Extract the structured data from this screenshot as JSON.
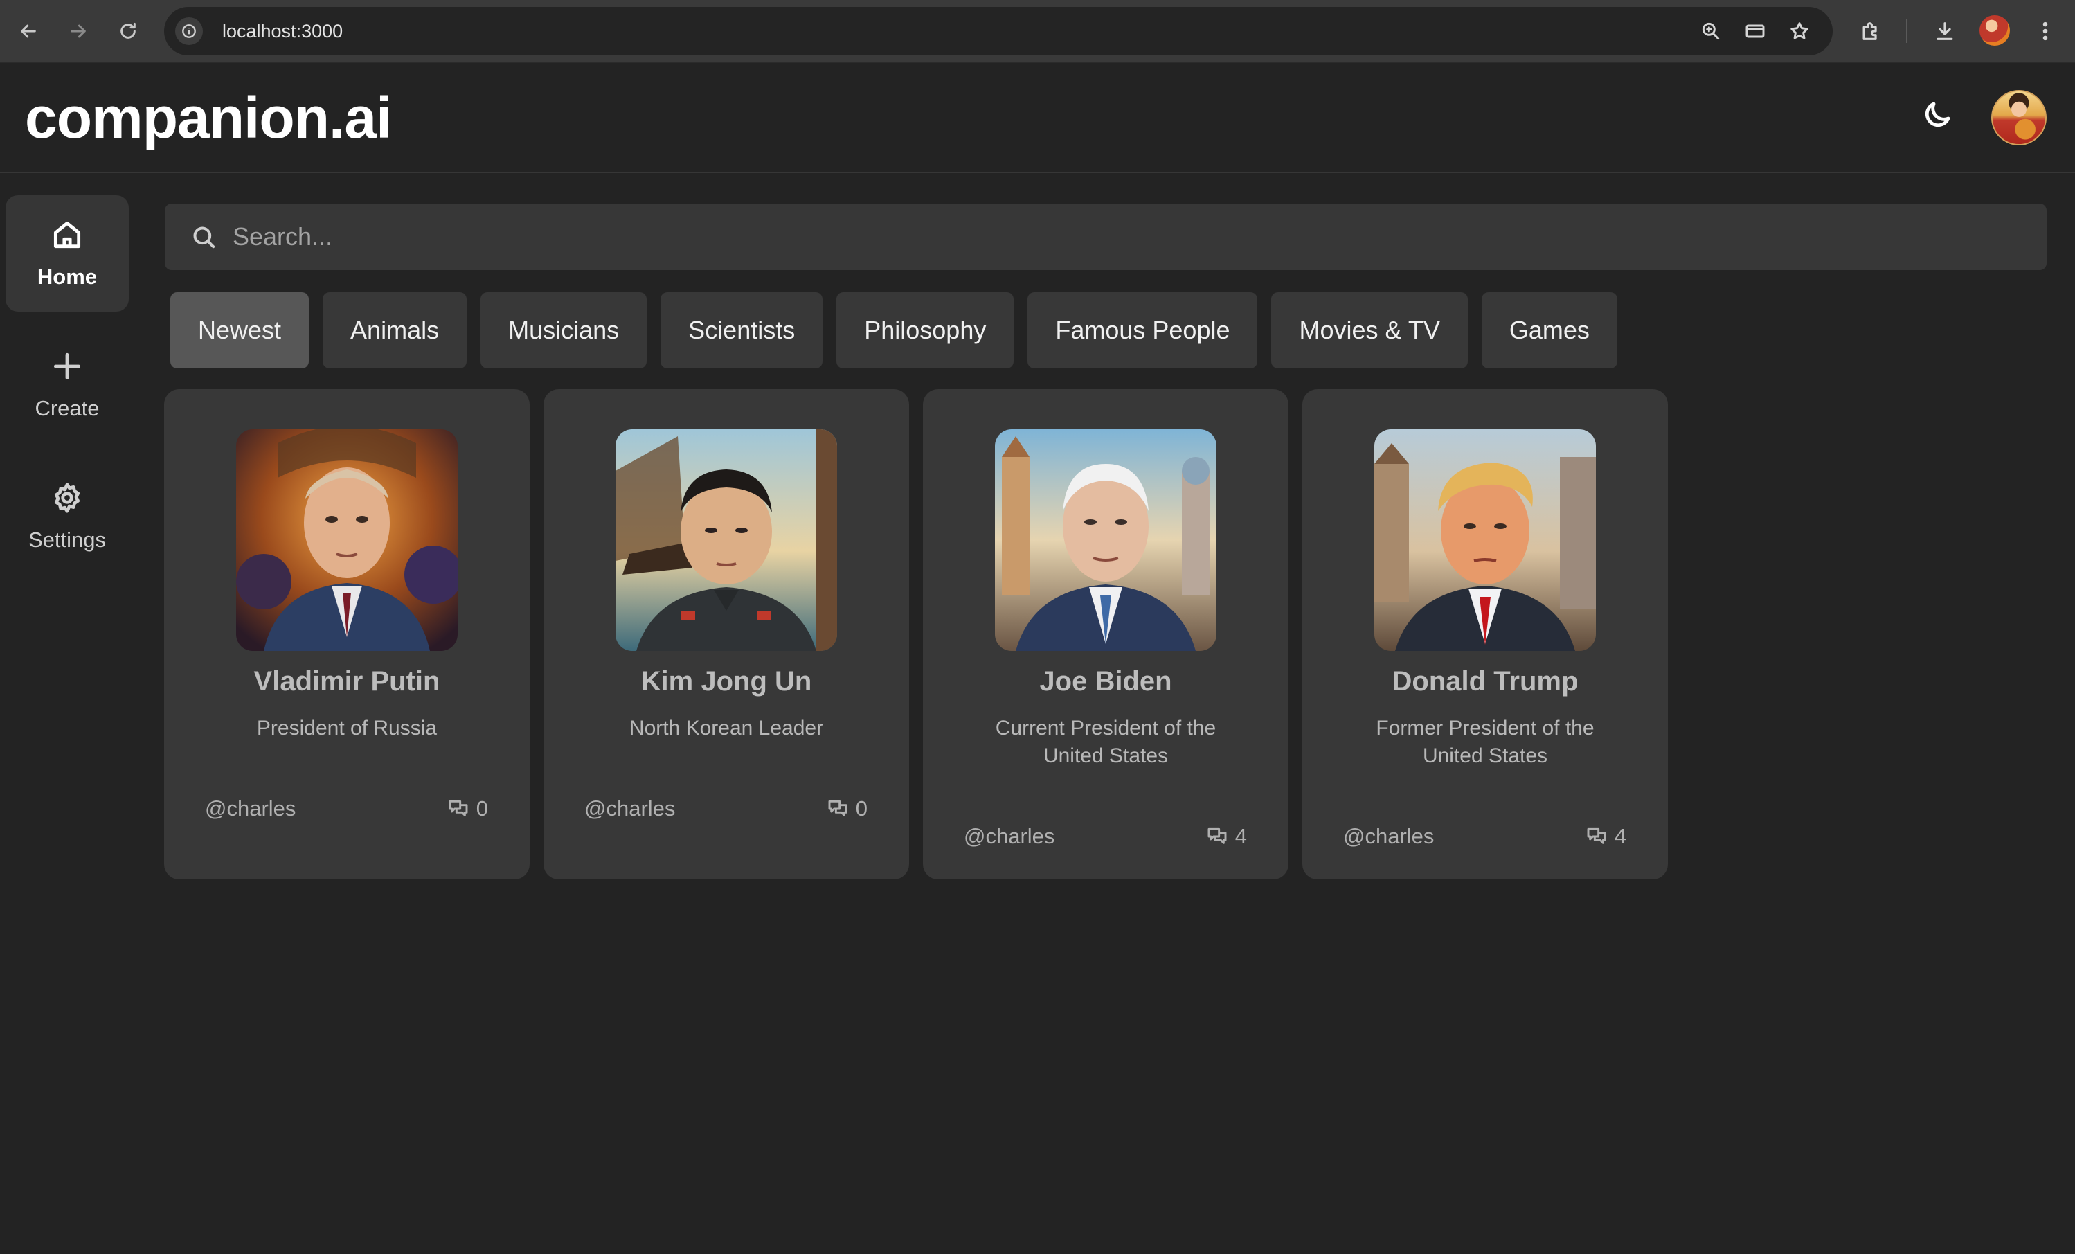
{
  "browser": {
    "url": "localhost:3000"
  },
  "app": {
    "logo": "companion.ai"
  },
  "sidebar": {
    "items": [
      {
        "label": "Home",
        "icon": "home-icon"
      },
      {
        "label": "Create",
        "icon": "plus-icon"
      },
      {
        "label": "Settings",
        "icon": "gear-icon"
      }
    ]
  },
  "search": {
    "placeholder": "Search..."
  },
  "categories": [
    "Newest",
    "Animals",
    "Musicians",
    "Scientists",
    "Philosophy",
    "Famous People",
    "Movies & TV",
    "Games"
  ],
  "companions": [
    {
      "name": "Vladimir Putin",
      "description": "President of Russia",
      "author": "@charles",
      "message_count": "0"
    },
    {
      "name": "Kim Jong Un",
      "description": "North Korean Leader",
      "author": "@charles",
      "message_count": "0"
    },
    {
      "name": "Joe Biden",
      "description": "Current President of the United States",
      "author": "@charles",
      "message_count": "4"
    },
    {
      "name": "Donald Trump",
      "description": "Former President of the United States",
      "author": "@charles",
      "message_count": "4"
    }
  ],
  "colors": {
    "background": "#232323",
    "card": "#383838",
    "active_category": "#575757"
  }
}
